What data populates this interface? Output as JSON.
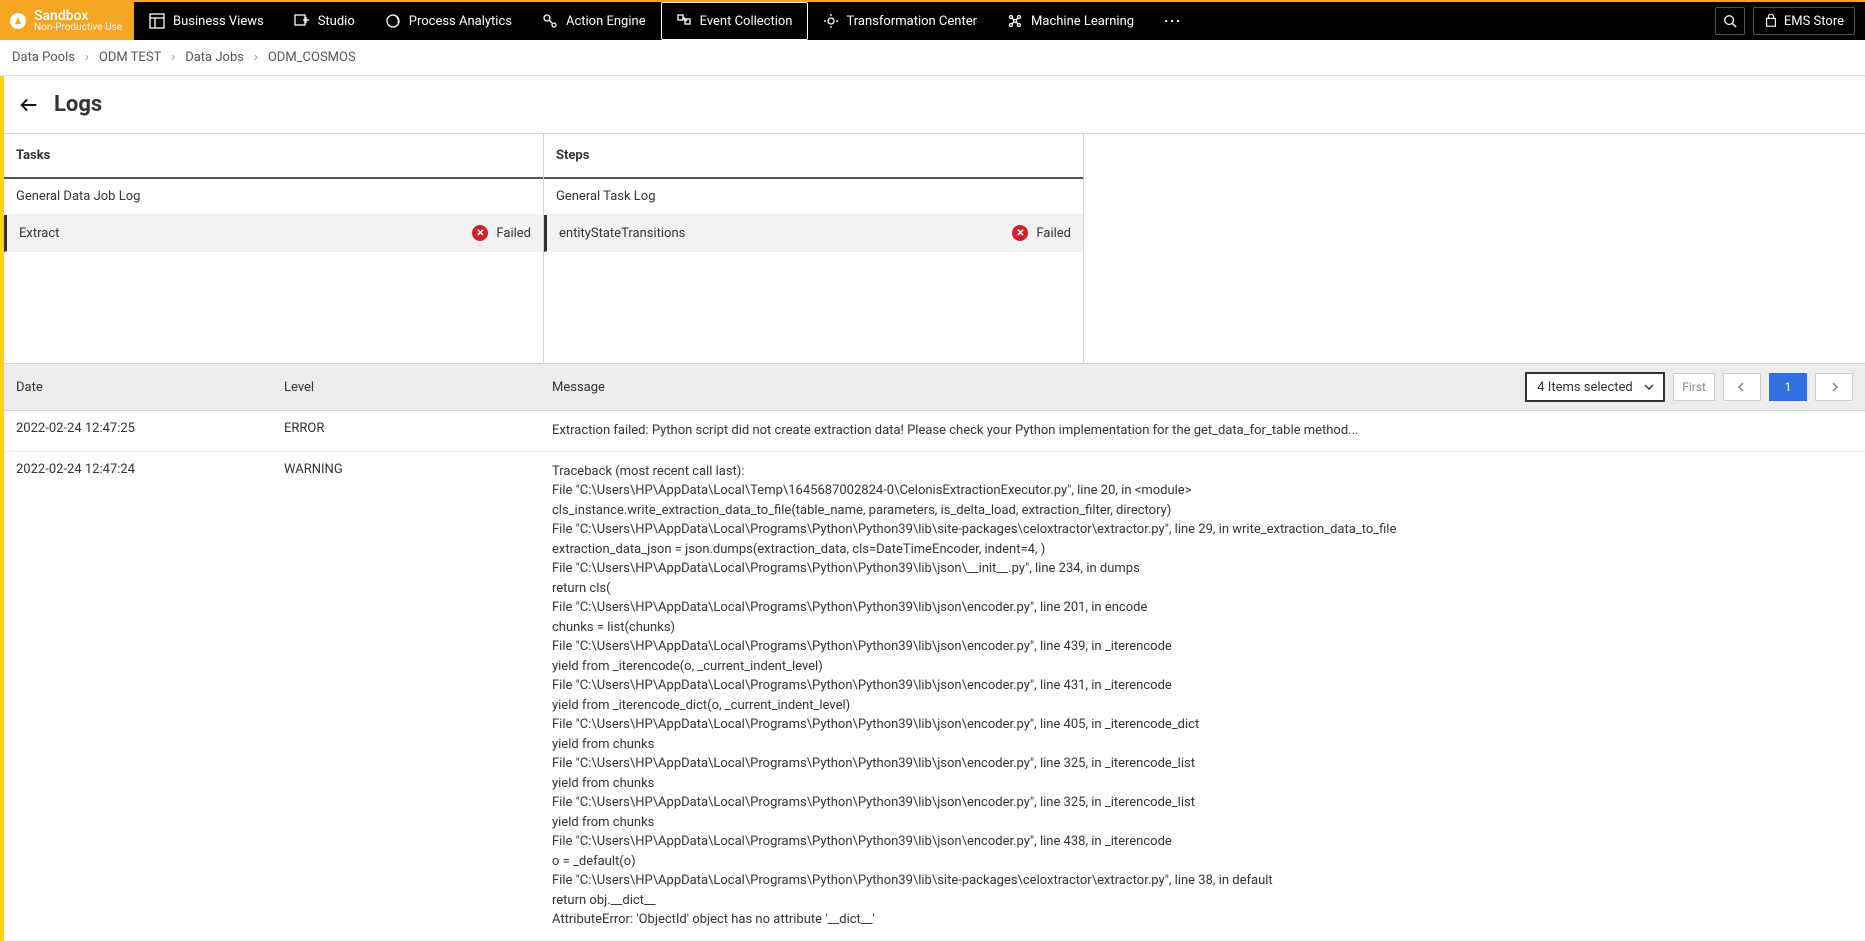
{
  "brand": {
    "title": "Sandbox",
    "subtitle": "Non-Productive Use"
  },
  "nav": [
    {
      "label": "Business Views",
      "active": false
    },
    {
      "label": "Studio",
      "active": false
    },
    {
      "label": "Process Analytics",
      "active": false
    },
    {
      "label": "Action Engine",
      "active": false
    },
    {
      "label": "Event Collection",
      "active": true
    },
    {
      "label": "Transformation Center",
      "active": false
    },
    {
      "label": "Machine Learning",
      "active": false
    }
  ],
  "ems_store_label": "EMS Store",
  "breadcrumbs": [
    "Data Pools",
    "ODM TEST",
    "Data Jobs",
    "ODM_COSMOS"
  ],
  "page_title": "Logs",
  "panels": {
    "tasks": {
      "header": "Tasks",
      "items": [
        {
          "label": "General Data Job Log",
          "status": null,
          "selected": false
        },
        {
          "label": "Extract",
          "status": "Failed",
          "selected": true
        }
      ]
    },
    "steps": {
      "header": "Steps",
      "items": [
        {
          "label": "General Task Log",
          "status": null,
          "selected": false
        },
        {
          "label": "entityStateTransitions",
          "status": "Failed",
          "selected": true
        }
      ]
    }
  },
  "log_table": {
    "headers": {
      "date": "Date",
      "level": "Level",
      "message": "Message"
    },
    "filter_label": "4 Items selected",
    "pagination": {
      "first": "First",
      "current": "1"
    },
    "rows": [
      {
        "date": "2022-02-24 12:47:25",
        "level": "ERROR",
        "message": "Extraction failed: Python script did not create extraction data! Please check your Python implementation for the get_data_for_table method..."
      },
      {
        "date": "2022-02-24 12:47:24",
        "level": "WARNING",
        "message": "Traceback (most recent call last):\nFile \"C:\\Users\\HP\\AppData\\Local\\Temp\\1645687002824-0\\CelonisExtractionExecutor.py\", line 20, in <module>\ncls_instance.write_extraction_data_to_file(table_name, parameters, is_delta_load, extraction_filter, directory)\nFile \"C:\\Users\\HP\\AppData\\Local\\Programs\\Python\\Python39\\lib\\site-packages\\celoxtractor\\extractor.py\", line 29, in write_extraction_data_to_file\nextraction_data_json = json.dumps(extraction_data, cls=DateTimeEncoder, indent=4, )\nFile \"C:\\Users\\HP\\AppData\\Local\\Programs\\Python\\Python39\\lib\\json\\__init__.py\", line 234, in dumps\nreturn cls(\nFile \"C:\\Users\\HP\\AppData\\Local\\Programs\\Python\\Python39\\lib\\json\\encoder.py\", line 201, in encode\nchunks = list(chunks)\nFile \"C:\\Users\\HP\\AppData\\Local\\Programs\\Python\\Python39\\lib\\json\\encoder.py\", line 439, in _iterencode\nyield from _iterencode(o, _current_indent_level)\nFile \"C:\\Users\\HP\\AppData\\Local\\Programs\\Python\\Python39\\lib\\json\\encoder.py\", line 431, in _iterencode\nyield from _iterencode_dict(o, _current_indent_level)\nFile \"C:\\Users\\HP\\AppData\\Local\\Programs\\Python\\Python39\\lib\\json\\encoder.py\", line 405, in _iterencode_dict\nyield from chunks\nFile \"C:\\Users\\HP\\AppData\\Local\\Programs\\Python\\Python39\\lib\\json\\encoder.py\", line 325, in _iterencode_list\nyield from chunks\nFile \"C:\\Users\\HP\\AppData\\Local\\Programs\\Python\\Python39\\lib\\json\\encoder.py\", line 325, in _iterencode_list\nyield from chunks\nFile \"C:\\Users\\HP\\AppData\\Local\\Programs\\Python\\Python39\\lib\\json\\encoder.py\", line 438, in _iterencode\no = _default(o)\nFile \"C:\\Users\\HP\\AppData\\Local\\Programs\\Python\\Python39\\lib\\site-packages\\celoxtractor\\extractor.py\", line 38, in default\nreturn obj.__dict__\nAttributeError: 'ObjectId' object has no attribute '__dict__'"
      }
    ]
  }
}
